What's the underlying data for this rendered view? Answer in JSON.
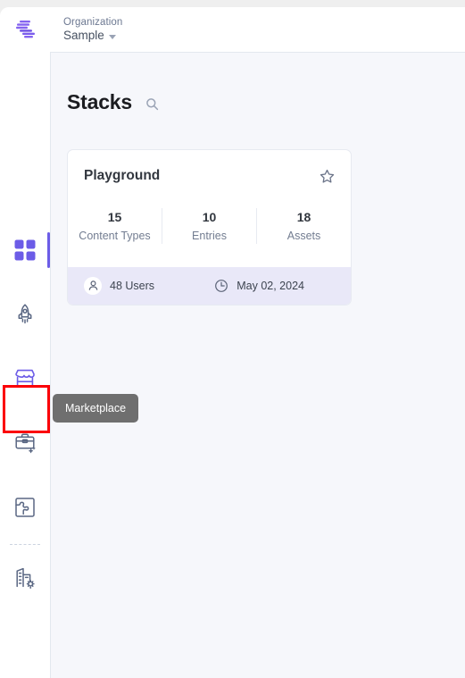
{
  "header": {
    "logo_icon": "contentstack-logo-icon",
    "org_label": "Organization",
    "org_name": "Sample",
    "caret_icon": "chevron-down-icon"
  },
  "sidebar": {
    "items": [
      {
        "icon": "grid-icon",
        "name": "dashboard",
        "active": true
      },
      {
        "icon": "rocket-icon",
        "name": "launch",
        "active": false
      },
      {
        "icon": "storefront-icon",
        "name": "marketplace",
        "active": false,
        "highlighted": true
      },
      {
        "icon": "briefcase-sparkle-icon",
        "name": "automations",
        "active": false
      },
      {
        "icon": "puzzle-icon",
        "name": "extensions",
        "active": false
      },
      {
        "icon": "building-gear-icon",
        "name": "org-settings",
        "active": false
      }
    ],
    "tooltip": "Marketplace"
  },
  "main": {
    "page_title": "Stacks",
    "search_icon": "search-icon"
  },
  "card": {
    "title": "Playground",
    "star_icon": "star-outline-icon",
    "stats": [
      {
        "value": "15",
        "label": "Content Types"
      },
      {
        "value": "10",
        "label": "Entries"
      },
      {
        "value": "18",
        "label": "Assets"
      }
    ],
    "footer": {
      "users_icon": "user-icon",
      "users_text": "48 Users",
      "date_icon": "clock-icon",
      "date_text": "May 02, 2024"
    }
  },
  "colors": {
    "accent_purple": "#6c5ce7",
    "icon_slate": "#5a6783",
    "highlight_red": "#fb0007",
    "footer_lavender": "#e9e8f8",
    "tooltip_grey": "#6f6f6f"
  }
}
